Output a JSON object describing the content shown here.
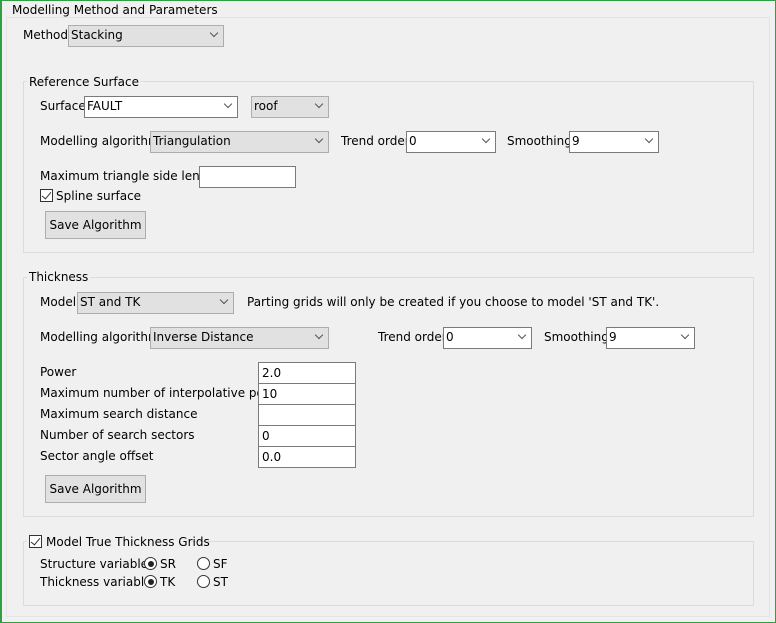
{
  "title": "Modelling Method and Parameters",
  "method": {
    "label": "Method",
    "value": "Stacking"
  },
  "reference": {
    "title": "Reference Surface",
    "surface_label": "Surface",
    "surface": "FAULT",
    "surface_part": "roof",
    "algo_label": "Modelling algorithm",
    "algo": "Triangulation",
    "trend_label": "Trend order",
    "trend": "0",
    "smooth_label": "Smoothing",
    "smooth": "9",
    "max_tri_label": "Maximum triangle side length",
    "max_tri": "",
    "spline_label": "Spline surface",
    "spline_checked": true,
    "save": "Save Algorithm"
  },
  "thickness": {
    "title": "Thickness",
    "model_label": "Model",
    "model": "ST and TK",
    "note": "Parting grids will only be created if you choose to model 'ST and TK'.",
    "algo_label": "Modelling algorithm",
    "algo": "Inverse Distance",
    "trend_label": "Trend order",
    "trend": "0",
    "smooth_label": "Smoothing",
    "smooth": "9",
    "params": [
      {
        "label": "Power",
        "value": "2.0"
      },
      {
        "label": "Maximum number of interpolative points",
        "value": "10"
      },
      {
        "label": "Maximum search distance",
        "value": ""
      },
      {
        "label": "Number of search sectors",
        "value": "0"
      },
      {
        "label": "Sector angle offset",
        "value": "0.0"
      }
    ],
    "save": "Save Algorithm"
  },
  "true_thickness": {
    "label": "Model True Thickness Grids",
    "checked": true,
    "structure_label": "Structure variable:",
    "structure_options": [
      "SR",
      "SF"
    ],
    "structure_selected": "SR",
    "thickness_label": "Thickness variable:",
    "thickness_options": [
      "TK",
      "ST"
    ],
    "thickness_selected": "TK"
  }
}
